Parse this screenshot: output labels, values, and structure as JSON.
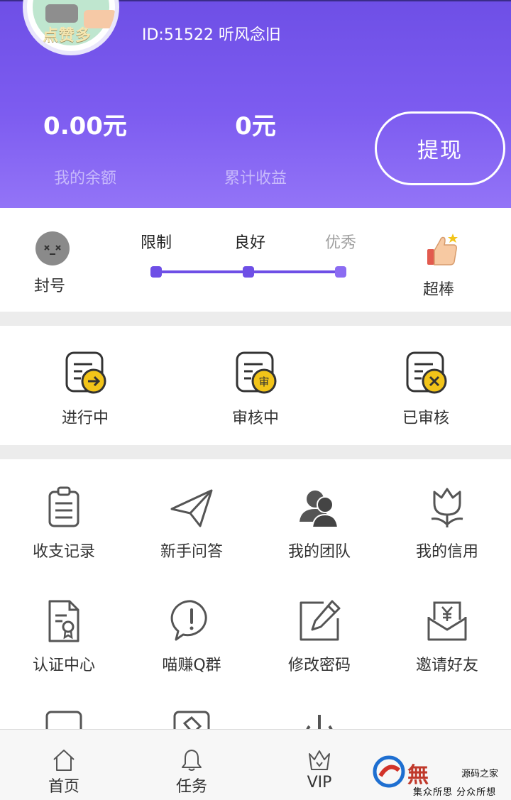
{
  "header": {
    "avatar_text": "点赞多",
    "user_id_text": "ID:51522 听风念旧",
    "balance_value": "0.00元",
    "balance_label": "我的余额",
    "total_value": "0元",
    "total_label": "累计收益",
    "withdraw_label": "提现"
  },
  "credit": {
    "banned_label": "封号",
    "levels": [
      "限制",
      "良好",
      "优秀"
    ],
    "super_label": "超棒",
    "colors": {
      "accent": "#6e4fe6",
      "badge": "#f2c419"
    }
  },
  "tasks": [
    {
      "label": "进行中",
      "icon": "document-arrow-icon"
    },
    {
      "label": "审核中",
      "icon": "document-review-icon",
      "badge_text": "审"
    },
    {
      "label": "已审核",
      "icon": "document-reviewed-icon"
    }
  ],
  "grid": [
    {
      "label": "收支记录",
      "icon": "clipboard-icon"
    },
    {
      "label": "新手问答",
      "icon": "paper-plane-icon"
    },
    {
      "label": "我的团队",
      "icon": "team-icon"
    },
    {
      "label": "我的信用",
      "icon": "tulip-icon"
    },
    {
      "label": "认证中心",
      "icon": "certificate-icon"
    },
    {
      "label": "喵赚Q群",
      "icon": "chat-alert-icon"
    },
    {
      "label": "修改密码",
      "icon": "edit-icon"
    },
    {
      "label": "邀请好友",
      "icon": "envelope-yen-icon"
    }
  ],
  "nav": [
    {
      "label": "首页",
      "icon": "home-icon"
    },
    {
      "label": "任务",
      "icon": "bell-icon"
    },
    {
      "label": "VIP",
      "icon": "crown-icon"
    }
  ],
  "watermark": {
    "main_text": "無",
    "side_text": "源码之家",
    "sub_text": "集众所思  分众所想"
  }
}
